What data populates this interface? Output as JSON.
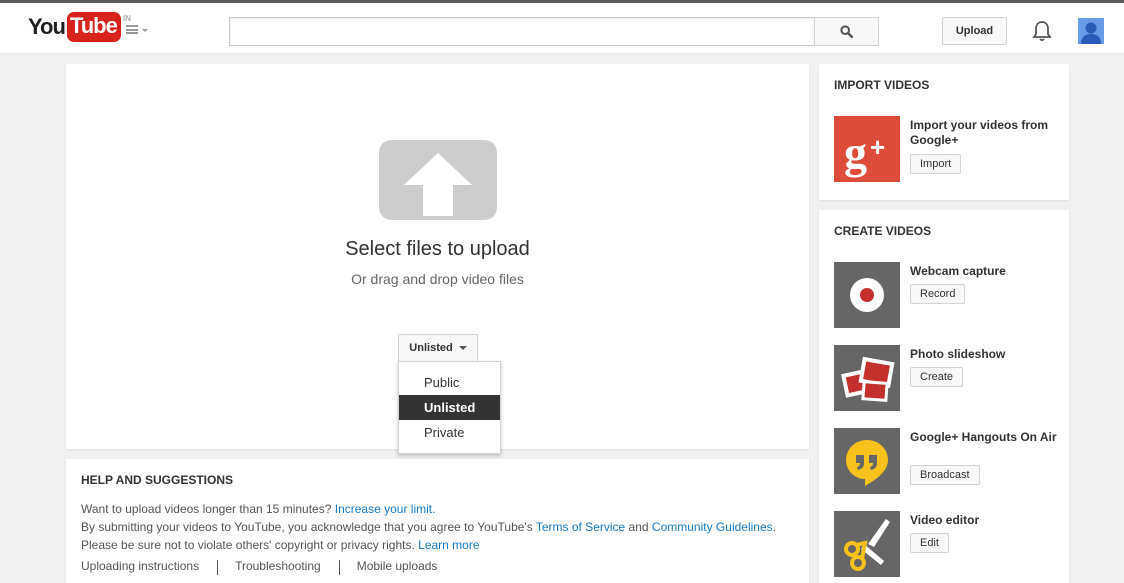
{
  "header": {
    "logo_you": "You",
    "logo_tube": "Tube",
    "logo_country": "IN",
    "search_placeholder": "",
    "upload_label": "Upload"
  },
  "upload": {
    "title": "Select files to upload",
    "subtitle": "Or drag and drop video files",
    "privacy_selected": "Unlisted",
    "privacy_options": [
      "Public",
      "Unlisted",
      "Private"
    ]
  },
  "help": {
    "title": "HELP AND SUGGESTIONS",
    "line1_text": "Want to upload videos longer than 15 minutes?",
    "line1_link": "Increase your limit.",
    "line2_text": "By submitting your videos to YouTube, you acknowledge that you agree to YouTube's",
    "line2_link1": "Terms of Service",
    "line2_and": "and",
    "line2_link2": "Community Guidelines",
    "line2_end": ".",
    "line3_text": "Please be sure not to violate others' copyright or privacy rights.",
    "line3_link": "Learn more",
    "links": [
      "Uploading instructions",
      "Troubleshooting",
      "Mobile uploads"
    ]
  },
  "import": {
    "title": "IMPORT VIDEOS",
    "item_label": "Import your videos from Google+",
    "item_button": "Import"
  },
  "create": {
    "title": "CREATE VIDEOS",
    "items": [
      {
        "label": "Webcam capture",
        "button": "Record"
      },
      {
        "label": "Photo slideshow",
        "button": "Create"
      },
      {
        "label": "Google+ Hangouts On Air",
        "button": "Broadcast"
      },
      {
        "label": "Video editor",
        "button": "Edit"
      }
    ]
  },
  "colors": {
    "brand_red": "#d8231d",
    "google_plus_red": "#dd4b39",
    "hangouts_yellow": "#f7c21b",
    "link_blue": "#167ac6",
    "thumb_gray": "#666666"
  }
}
